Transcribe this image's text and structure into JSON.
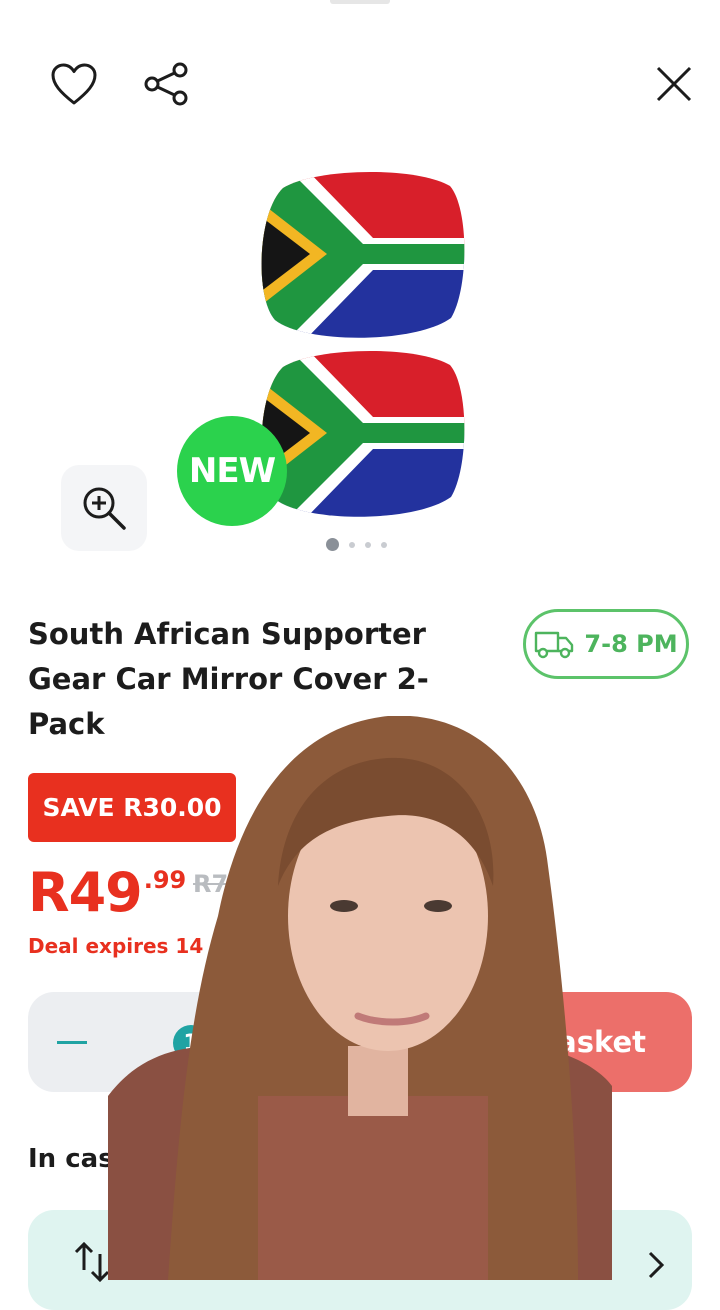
{
  "header": {
    "favourite_icon": "heart-icon",
    "share_icon": "share-icon",
    "close_icon": "close-icon"
  },
  "gallery": {
    "badge": "NEW",
    "zoom_icon": "zoom-in-icon",
    "pages": 4,
    "active_page": 1
  },
  "product": {
    "title": "South African Supporter Gear Car Mirror Cover 2-Pack",
    "delivery": "7-8 PM",
    "save": "SAVE R30.00",
    "price_main": "R49",
    "price_cents": ".99",
    "was_price": "R79",
    "deal": "Deal expires 14 Jun"
  },
  "cart": {
    "quantity": "1",
    "basket_label": "Basket"
  },
  "section": {
    "in_case": "In case"
  },
  "colors": {
    "accent_red": "#e8301f",
    "delivery_green": "#5cc36a",
    "new_green": "#2bd24d",
    "teal": "#20a3a3",
    "basket_button": "#ec6f6a"
  }
}
